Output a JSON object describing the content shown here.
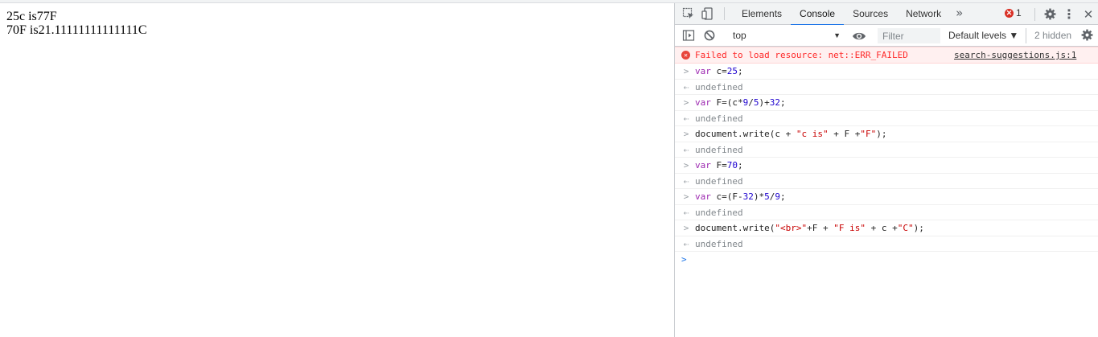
{
  "page": {
    "lines": [
      "25c is77F",
      "70F is21.11111111111111C"
    ]
  },
  "devtools": {
    "tabs": [
      {
        "label": "Elements",
        "active": false
      },
      {
        "label": "Console",
        "active": true
      },
      {
        "label": "Sources",
        "active": false
      },
      {
        "label": "Network",
        "active": false
      }
    ],
    "more_tabs": "»",
    "error_count": "1",
    "toolbar": {
      "context": "top",
      "filter_placeholder": "Filter",
      "levels": "Default levels ▼",
      "hidden": "2 hidden"
    },
    "error_message": {
      "text": "Failed to load resource: net::ERR_FAILED",
      "source": "search-suggestions.js:1"
    },
    "result_text": "undefined",
    "commands": [
      {
        "tokens": [
          {
            "t": "var ",
            "c": "kw"
          },
          {
            "t": "c=",
            "c": "plain"
          },
          {
            "t": "25",
            "c": "num"
          },
          {
            "t": ";",
            "c": "plain"
          }
        ]
      },
      {
        "tokens": [
          {
            "t": "var ",
            "c": "kw"
          },
          {
            "t": "F=(c*",
            "c": "plain"
          },
          {
            "t": "9",
            "c": "num"
          },
          {
            "t": "/",
            "c": "plain"
          },
          {
            "t": "5",
            "c": "num"
          },
          {
            "t": ")+",
            "c": "plain"
          },
          {
            "t": "32",
            "c": "num"
          },
          {
            "t": ";",
            "c": "plain"
          }
        ]
      },
      {
        "tokens": [
          {
            "t": "document.write(c + ",
            "c": "plain"
          },
          {
            "t": "\"c is\"",
            "c": "str"
          },
          {
            "t": " + F +",
            "c": "plain"
          },
          {
            "t": "\"F\"",
            "c": "str"
          },
          {
            "t": ");",
            "c": "plain"
          }
        ]
      },
      {
        "tokens": [
          {
            "t": "var ",
            "c": "kw"
          },
          {
            "t": "F=",
            "c": "plain"
          },
          {
            "t": "70",
            "c": "num"
          },
          {
            "t": ";",
            "c": "plain"
          }
        ]
      },
      {
        "tokens": [
          {
            "t": "var ",
            "c": "kw"
          },
          {
            "t": "c=(F-",
            "c": "plain"
          },
          {
            "t": "32",
            "c": "num"
          },
          {
            "t": ")*",
            "c": "plain"
          },
          {
            "t": "5",
            "c": "num"
          },
          {
            "t": "/",
            "c": "plain"
          },
          {
            "t": "9",
            "c": "num"
          },
          {
            "t": ";",
            "c": "plain"
          }
        ]
      },
      {
        "tokens": [
          {
            "t": "document.write(",
            "c": "plain"
          },
          {
            "t": "\"<br>\"",
            "c": "str"
          },
          {
            "t": "+F + ",
            "c": "plain"
          },
          {
            "t": "\"F is\"",
            "c": "str"
          },
          {
            "t": " + c +",
            "c": "plain"
          },
          {
            "t": "\"C\"",
            "c": "str"
          },
          {
            "t": ");",
            "c": "plain"
          }
        ]
      }
    ]
  }
}
